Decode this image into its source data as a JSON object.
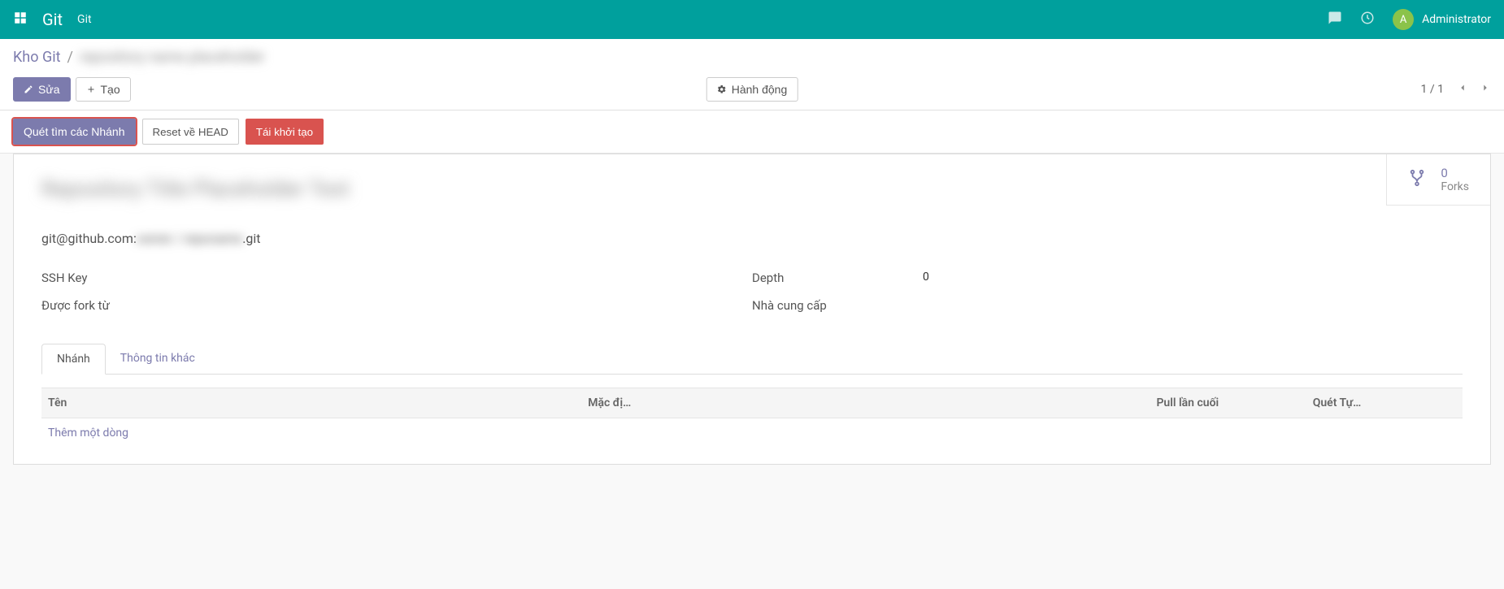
{
  "topbar": {
    "brand": "Git",
    "menu_git": "Git",
    "user_initial": "A",
    "user_name": "Administrator"
  },
  "breadcrumb": {
    "root": "Kho Git",
    "sep": "/",
    "current": "repository name placeholder"
  },
  "actions": {
    "edit": "Sửa",
    "create": "Tạo",
    "action_menu": "Hành động",
    "pager": "1 / 1"
  },
  "status_buttons": {
    "scan": "Quét tìm các Nhánh",
    "reset": "Reset về HEAD",
    "reinit": "Tái khởi tạo"
  },
  "forks": {
    "count": "0",
    "label": "Forks"
  },
  "repo": {
    "title": "Repository Title Placeholder Text",
    "url_prefix": "git@github.com:",
    "url_blur": "owner / reponame",
    "url_suffix": ".git"
  },
  "fields": {
    "ssh_key_label": "SSH Key",
    "ssh_key_value": "",
    "forked_label": "Được fork từ",
    "forked_value": "",
    "depth_label": "Depth",
    "depth_value": "0",
    "provider_label": "Nhà cung cấp",
    "provider_value": ""
  },
  "tabs": {
    "branches": "Nhánh",
    "other": "Thông tin khác"
  },
  "table": {
    "col_name": "Tên",
    "col_default": "Mặc đị…",
    "col_last_pull": "Pull lần cuối",
    "col_auto_scan": "Quét Tự…",
    "add_line": "Thêm một dòng"
  }
}
